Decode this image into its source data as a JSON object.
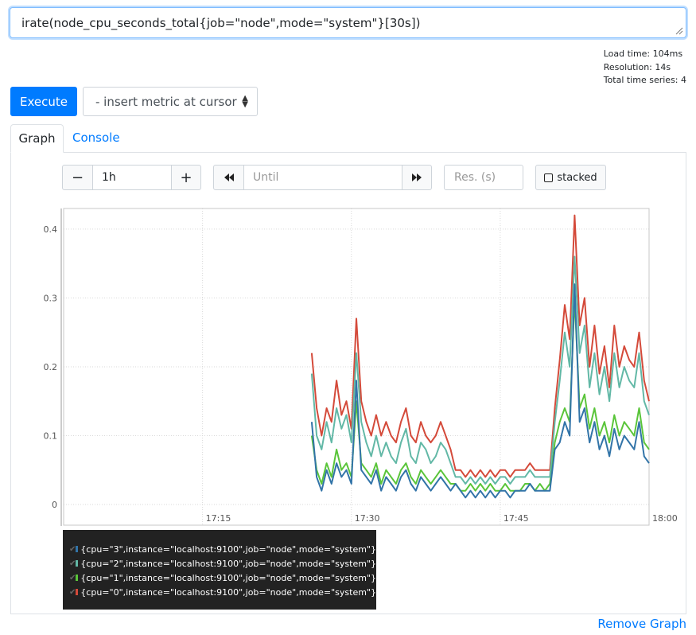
{
  "query": {
    "expression": "irate(node_cpu_seconds_total{job=\"node\",mode=\"system\"}[30s])"
  },
  "stats": {
    "load_time": "Load time: 104ms",
    "resolution": "Resolution: 14s",
    "total_series": "Total time series: 4"
  },
  "toolbar": {
    "execute_label": "Execute",
    "metric_select": "- insert metric at cursor"
  },
  "tabs": [
    {
      "label": "Graph",
      "active": true
    },
    {
      "label": "Console",
      "active": false
    }
  ],
  "controls": {
    "minus": "−",
    "range_value": "1h",
    "plus": "+",
    "until_placeholder": "Until",
    "res_placeholder": "Res. (s)",
    "stacked_label": "stacked"
  },
  "chart_data": {
    "type": "line",
    "x_ticks": [
      "17:15",
      "17:30",
      "17:45",
      "18:00"
    ],
    "y_ticks": [
      "0",
      "0.1",
      "0.2",
      "0.3",
      "0.4"
    ],
    "xlim": [
      "17:01",
      "18:00"
    ],
    "ylim": [
      0,
      0.46
    ],
    "grid": true,
    "legend": "below",
    "series": [
      {
        "name": "{cpu=\"3\",instance=\"localhost:9100\",job=\"node\",mode=\"system\"}",
        "color": "#3274a8",
        "values": [
          0.12,
          0.04,
          0.02,
          0.05,
          0.03,
          0.06,
          0.04,
          0.05,
          0.03,
          0.18,
          0.05,
          0.04,
          0.03,
          0.05,
          0.02,
          0.04,
          0.03,
          0.02,
          0.04,
          0.05,
          0.03,
          0.02,
          0.04,
          0.03,
          0.02,
          0.03,
          0.04,
          0.03,
          0.02,
          0.03,
          0.02,
          0.01,
          0.02,
          0.01,
          0.02,
          0.01,
          0.02,
          0.01,
          0.02,
          0.02,
          0.01,
          0.02,
          0.02,
          0.02,
          0.03,
          0.02,
          0.02,
          0.02,
          0.02,
          0.08,
          0.09,
          0.12,
          0.1,
          0.32,
          0.12,
          0.14,
          0.09,
          0.12,
          0.08,
          0.1,
          0.07,
          0.11,
          0.08,
          0.1,
          0.09,
          0.08,
          0.12,
          0.07,
          0.06
        ]
      },
      {
        "name": "{cpu=\"2\",instance=\"localhost:9100\",job=\"node\",mode=\"system\"}",
        "color": "#62b8a6",
        "values": [
          0.19,
          0.1,
          0.08,
          0.12,
          0.09,
          0.14,
          0.11,
          0.13,
          0.09,
          0.22,
          0.12,
          0.09,
          0.07,
          0.1,
          0.07,
          0.09,
          0.07,
          0.06,
          0.09,
          0.11,
          0.07,
          0.06,
          0.09,
          0.08,
          0.06,
          0.07,
          0.09,
          0.08,
          0.06,
          0.04,
          0.04,
          0.03,
          0.04,
          0.03,
          0.04,
          0.03,
          0.04,
          0.03,
          0.04,
          0.04,
          0.03,
          0.04,
          0.04,
          0.04,
          0.05,
          0.04,
          0.04,
          0.04,
          0.04,
          0.12,
          0.18,
          0.25,
          0.2,
          0.36,
          0.22,
          0.26,
          0.17,
          0.22,
          0.16,
          0.2,
          0.15,
          0.22,
          0.17,
          0.2,
          0.18,
          0.17,
          0.22,
          0.15,
          0.13
        ]
      },
      {
        "name": "{cpu=\"1\",instance=\"localhost:9100\",job=\"node\",mode=\"system\"}",
        "color": "#5ac53a",
        "values": [
          0.1,
          0.05,
          0.03,
          0.06,
          0.04,
          0.08,
          0.05,
          0.06,
          0.04,
          0.15,
          0.06,
          0.05,
          0.04,
          0.06,
          0.03,
          0.05,
          0.04,
          0.03,
          0.05,
          0.06,
          0.04,
          0.03,
          0.05,
          0.04,
          0.03,
          0.04,
          0.05,
          0.04,
          0.03,
          0.03,
          0.02,
          0.02,
          0.03,
          0.02,
          0.03,
          0.02,
          0.03,
          0.02,
          0.02,
          0.03,
          0.02,
          0.02,
          0.02,
          0.03,
          0.03,
          0.02,
          0.03,
          0.02,
          0.03,
          0.09,
          0.12,
          0.14,
          0.12,
          0.3,
          0.14,
          0.16,
          0.11,
          0.14,
          0.1,
          0.12,
          0.09,
          0.13,
          0.1,
          0.12,
          0.11,
          0.1,
          0.14,
          0.09,
          0.08
        ]
      },
      {
        "name": "{cpu=\"0\",instance=\"localhost:9100\",job=\"node\",mode=\"system\"}",
        "color": "#d44a3a",
        "values": [
          0.22,
          0.14,
          0.1,
          0.14,
          0.12,
          0.18,
          0.13,
          0.15,
          0.11,
          0.27,
          0.15,
          0.12,
          0.1,
          0.13,
          0.1,
          0.12,
          0.1,
          0.09,
          0.12,
          0.14,
          0.1,
          0.09,
          0.12,
          0.1,
          0.09,
          0.1,
          0.12,
          0.1,
          0.08,
          0.05,
          0.05,
          0.04,
          0.05,
          0.04,
          0.05,
          0.04,
          0.05,
          0.04,
          0.05,
          0.05,
          0.04,
          0.05,
          0.05,
          0.05,
          0.06,
          0.05,
          0.05,
          0.05,
          0.05,
          0.14,
          0.21,
          0.29,
          0.24,
          0.42,
          0.26,
          0.3,
          0.2,
          0.26,
          0.19,
          0.23,
          0.17,
          0.26,
          0.2,
          0.23,
          0.21,
          0.2,
          0.25,
          0.18,
          0.15
        ]
      }
    ]
  },
  "legend_check": "✔",
  "remove_graph_label": "Remove Graph"
}
